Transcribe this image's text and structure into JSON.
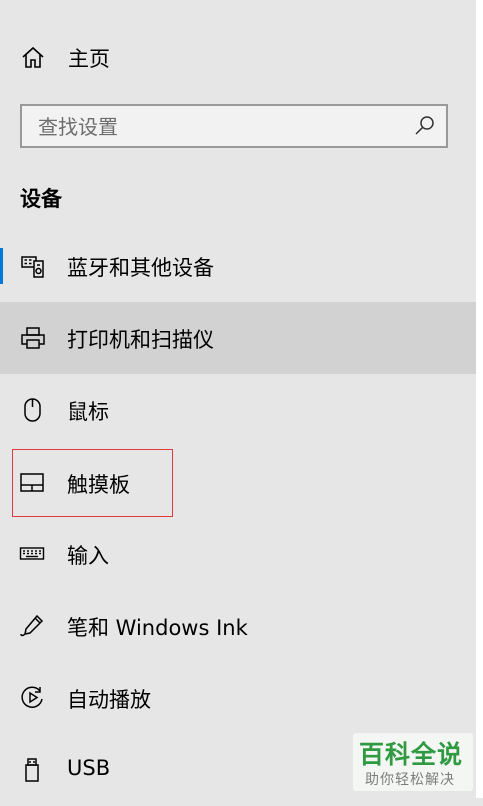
{
  "home": {
    "label": "主页",
    "icon": "home-icon"
  },
  "search": {
    "placeholder": "查找设置",
    "icon": "search-icon"
  },
  "section": {
    "title": "设备"
  },
  "nav": {
    "items": [
      {
        "label": "蓝牙和其他设备",
        "icon": "bluetooth-devices-icon"
      },
      {
        "label": "打印机和扫描仪",
        "icon": "printer-icon"
      },
      {
        "label": "鼠标",
        "icon": "mouse-icon"
      },
      {
        "label": "触摸板",
        "icon": "touchpad-icon"
      },
      {
        "label": "输入",
        "icon": "keyboard-icon"
      },
      {
        "label": "笔和 Windows Ink",
        "icon": "pen-icon"
      },
      {
        "label": "自动播放",
        "icon": "autoplay-icon"
      },
      {
        "label": "USB",
        "icon": "usb-icon"
      }
    ]
  },
  "watermark": {
    "title": "百科全说",
    "subtitle": "助你轻松解决"
  },
  "colors": {
    "accent": "#0078d7",
    "hover_bg": "#d2d2d2",
    "highlight": "#e0393e",
    "watermark_green": "#2f9a42"
  }
}
